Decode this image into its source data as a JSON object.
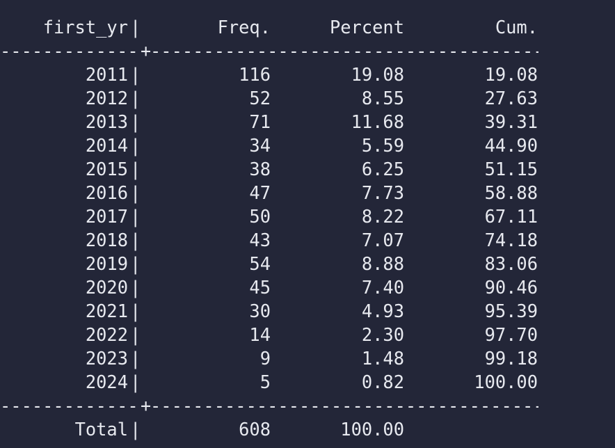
{
  "table": {
    "header": {
      "label": "first_yr",
      "separator": "|",
      "freq": "Freq.",
      "percent": "Percent",
      "cum": "Cum."
    },
    "rule_left": "--------------------------------",
    "rule_cross": "+",
    "rule_right": "--------------------------------------------------------------------------------",
    "rows": [
      {
        "year": "2011",
        "sep": "|",
        "freq": "116",
        "percent": "19.08",
        "cum": "19.08"
      },
      {
        "year": "2012",
        "sep": "|",
        "freq": "52",
        "percent": "8.55",
        "cum": "27.63"
      },
      {
        "year": "2013",
        "sep": "|",
        "freq": "71",
        "percent": "11.68",
        "cum": "39.31"
      },
      {
        "year": "2014",
        "sep": "|",
        "freq": "34",
        "percent": "5.59",
        "cum": "44.90"
      },
      {
        "year": "2015",
        "sep": "|",
        "freq": "38",
        "percent": "6.25",
        "cum": "51.15"
      },
      {
        "year": "2016",
        "sep": "|",
        "freq": "47",
        "percent": "7.73",
        "cum": "58.88"
      },
      {
        "year": "2017",
        "sep": "|",
        "freq": "50",
        "percent": "8.22",
        "cum": "67.11"
      },
      {
        "year": "2018",
        "sep": "|",
        "freq": "43",
        "percent": "7.07",
        "cum": "74.18"
      },
      {
        "year": "2019",
        "sep": "|",
        "freq": "54",
        "percent": "8.88",
        "cum": "83.06"
      },
      {
        "year": "2020",
        "sep": "|",
        "freq": "45",
        "percent": "7.40",
        "cum": "90.46"
      },
      {
        "year": "2021",
        "sep": "|",
        "freq": "30",
        "percent": "4.93",
        "cum": "95.39"
      },
      {
        "year": "2022",
        "sep": "|",
        "freq": "14",
        "percent": "2.30",
        "cum": "97.70"
      },
      {
        "year": "2023",
        "sep": "|",
        "freq": "9",
        "percent": "1.48",
        "cum": "99.18"
      },
      {
        "year": "2024",
        "sep": "|",
        "freq": "5",
        "percent": "0.82",
        "cum": "100.00"
      }
    ],
    "total": {
      "label": "Total",
      "sep": "|",
      "freq": "608",
      "percent": "100.00",
      "cum": ""
    }
  }
}
